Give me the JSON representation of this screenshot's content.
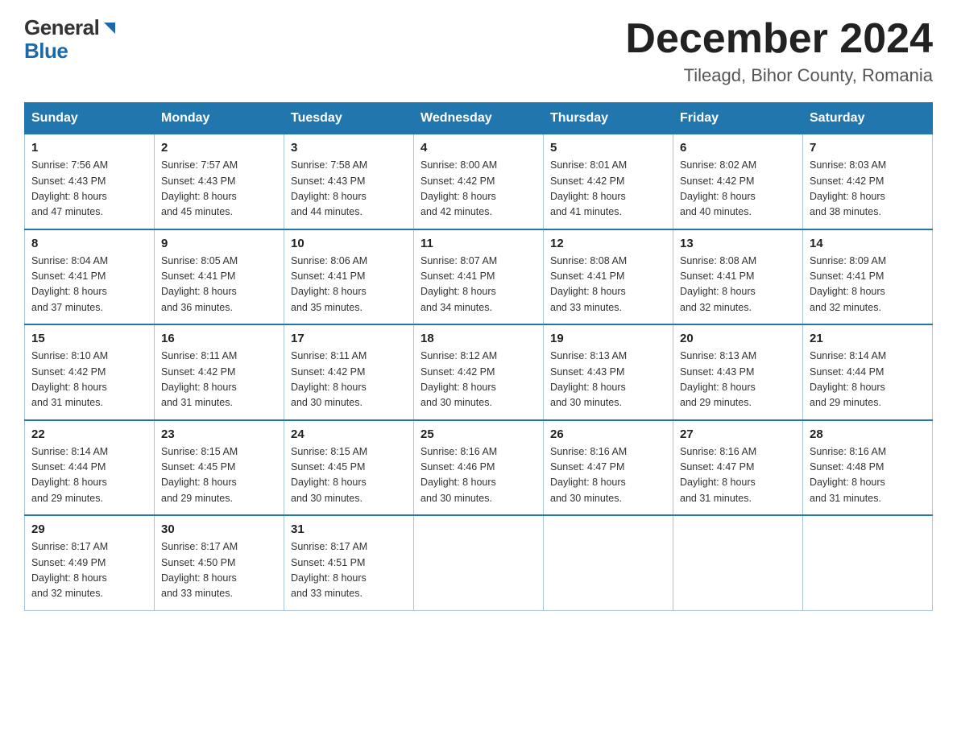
{
  "header": {
    "logo_general": "General",
    "logo_blue": "Blue",
    "month_title": "December 2024",
    "location": "Tileagd, Bihor County, Romania"
  },
  "days_of_week": [
    "Sunday",
    "Monday",
    "Tuesday",
    "Wednesday",
    "Thursday",
    "Friday",
    "Saturday"
  ],
  "weeks": [
    [
      {
        "day": "1",
        "sunrise": "7:56 AM",
        "sunset": "4:43 PM",
        "daylight": "8 hours and 47 minutes."
      },
      {
        "day": "2",
        "sunrise": "7:57 AM",
        "sunset": "4:43 PM",
        "daylight": "8 hours and 45 minutes."
      },
      {
        "day": "3",
        "sunrise": "7:58 AM",
        "sunset": "4:43 PM",
        "daylight": "8 hours and 44 minutes."
      },
      {
        "day": "4",
        "sunrise": "8:00 AM",
        "sunset": "4:42 PM",
        "daylight": "8 hours and 42 minutes."
      },
      {
        "day": "5",
        "sunrise": "8:01 AM",
        "sunset": "4:42 PM",
        "daylight": "8 hours and 41 minutes."
      },
      {
        "day": "6",
        "sunrise": "8:02 AM",
        "sunset": "4:42 PM",
        "daylight": "8 hours and 40 minutes."
      },
      {
        "day": "7",
        "sunrise": "8:03 AM",
        "sunset": "4:42 PM",
        "daylight": "8 hours and 38 minutes."
      }
    ],
    [
      {
        "day": "8",
        "sunrise": "8:04 AM",
        "sunset": "4:41 PM",
        "daylight": "8 hours and 37 minutes."
      },
      {
        "day": "9",
        "sunrise": "8:05 AM",
        "sunset": "4:41 PM",
        "daylight": "8 hours and 36 minutes."
      },
      {
        "day": "10",
        "sunrise": "8:06 AM",
        "sunset": "4:41 PM",
        "daylight": "8 hours and 35 minutes."
      },
      {
        "day": "11",
        "sunrise": "8:07 AM",
        "sunset": "4:41 PM",
        "daylight": "8 hours and 34 minutes."
      },
      {
        "day": "12",
        "sunrise": "8:08 AM",
        "sunset": "4:41 PM",
        "daylight": "8 hours and 33 minutes."
      },
      {
        "day": "13",
        "sunrise": "8:08 AM",
        "sunset": "4:41 PM",
        "daylight": "8 hours and 32 minutes."
      },
      {
        "day": "14",
        "sunrise": "8:09 AM",
        "sunset": "4:41 PM",
        "daylight": "8 hours and 32 minutes."
      }
    ],
    [
      {
        "day": "15",
        "sunrise": "8:10 AM",
        "sunset": "4:42 PM",
        "daylight": "8 hours and 31 minutes."
      },
      {
        "day": "16",
        "sunrise": "8:11 AM",
        "sunset": "4:42 PM",
        "daylight": "8 hours and 31 minutes."
      },
      {
        "day": "17",
        "sunrise": "8:11 AM",
        "sunset": "4:42 PM",
        "daylight": "8 hours and 30 minutes."
      },
      {
        "day": "18",
        "sunrise": "8:12 AM",
        "sunset": "4:42 PM",
        "daylight": "8 hours and 30 minutes."
      },
      {
        "day": "19",
        "sunrise": "8:13 AM",
        "sunset": "4:43 PM",
        "daylight": "8 hours and 30 minutes."
      },
      {
        "day": "20",
        "sunrise": "8:13 AM",
        "sunset": "4:43 PM",
        "daylight": "8 hours and 29 minutes."
      },
      {
        "day": "21",
        "sunrise": "8:14 AM",
        "sunset": "4:44 PM",
        "daylight": "8 hours and 29 minutes."
      }
    ],
    [
      {
        "day": "22",
        "sunrise": "8:14 AM",
        "sunset": "4:44 PM",
        "daylight": "8 hours and 29 minutes."
      },
      {
        "day": "23",
        "sunrise": "8:15 AM",
        "sunset": "4:45 PM",
        "daylight": "8 hours and 29 minutes."
      },
      {
        "day": "24",
        "sunrise": "8:15 AM",
        "sunset": "4:45 PM",
        "daylight": "8 hours and 30 minutes."
      },
      {
        "day": "25",
        "sunrise": "8:16 AM",
        "sunset": "4:46 PM",
        "daylight": "8 hours and 30 minutes."
      },
      {
        "day": "26",
        "sunrise": "8:16 AM",
        "sunset": "4:47 PM",
        "daylight": "8 hours and 30 minutes."
      },
      {
        "day": "27",
        "sunrise": "8:16 AM",
        "sunset": "4:47 PM",
        "daylight": "8 hours and 31 minutes."
      },
      {
        "day": "28",
        "sunrise": "8:16 AM",
        "sunset": "4:48 PM",
        "daylight": "8 hours and 31 minutes."
      }
    ],
    [
      {
        "day": "29",
        "sunrise": "8:17 AM",
        "sunset": "4:49 PM",
        "daylight": "8 hours and 32 minutes."
      },
      {
        "day": "30",
        "sunrise": "8:17 AM",
        "sunset": "4:50 PM",
        "daylight": "8 hours and 33 minutes."
      },
      {
        "day": "31",
        "sunrise": "8:17 AM",
        "sunset": "4:51 PM",
        "daylight": "8 hours and 33 minutes."
      },
      null,
      null,
      null,
      null
    ]
  ],
  "sunrise_label": "Sunrise:",
  "sunset_label": "Sunset:",
  "daylight_label": "Daylight:"
}
